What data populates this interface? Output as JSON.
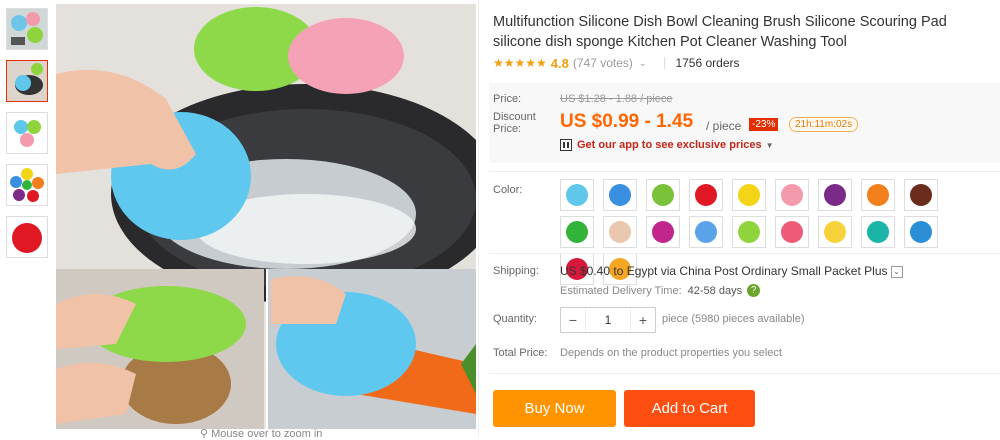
{
  "product": {
    "title": "Multifunction Silicone Dish Bowl Cleaning Brush Silicone Scouring Pad silicone dish sponge Kitchen Pot Cleaner Washing Tool",
    "stars": "★★★★★",
    "rating": "4.8",
    "votes": "(747 votes)",
    "orders": "1756 orders"
  },
  "price": {
    "price_label": "Price:",
    "old_price": "US $1.28 - 1.88 / piece",
    "discount_label": "Discount Price:",
    "new_price": "US $0.99 - 1.45",
    "unit": "/ piece",
    "discount_badge": "-23%",
    "timer": "21h:11m:02s",
    "app_link": "Get our app to see exclusive prices"
  },
  "color": {
    "label": "Color:",
    "swatch_colors": [
      "#5fc8ea",
      "#3a8fe0",
      "#7ac23a",
      "#e01823",
      "#f4d417",
      "#f39aad",
      "#7b2a89",
      "#f27f1b",
      "#6b2b1d",
      "#32b43a",
      "#e9c7b0",
      "#c0268c",
      "#5aa3e8",
      "#8fd43d",
      "#f05a7a",
      "#f7d23a",
      "#1bb5a8",
      "#2b8fd8",
      "#d8183a",
      "#f5a623"
    ]
  },
  "shipping": {
    "label": "Shipping:",
    "value": "US $0.40 to Egypt via China Post Ordinary Small Packet Plus",
    "eta_label": "Estimated Delivery Time:",
    "eta_days": "42-58 days"
  },
  "quantity": {
    "label": "Quantity:",
    "value": "1",
    "available": "piece (5980 pieces available)"
  },
  "total": {
    "label": "Total Price:",
    "value": "Depends on the product properties you select"
  },
  "buttons": {
    "buy": "Buy Now",
    "cart": "Add to Cart"
  },
  "zoom_hint": "Mouse over to zoom in"
}
